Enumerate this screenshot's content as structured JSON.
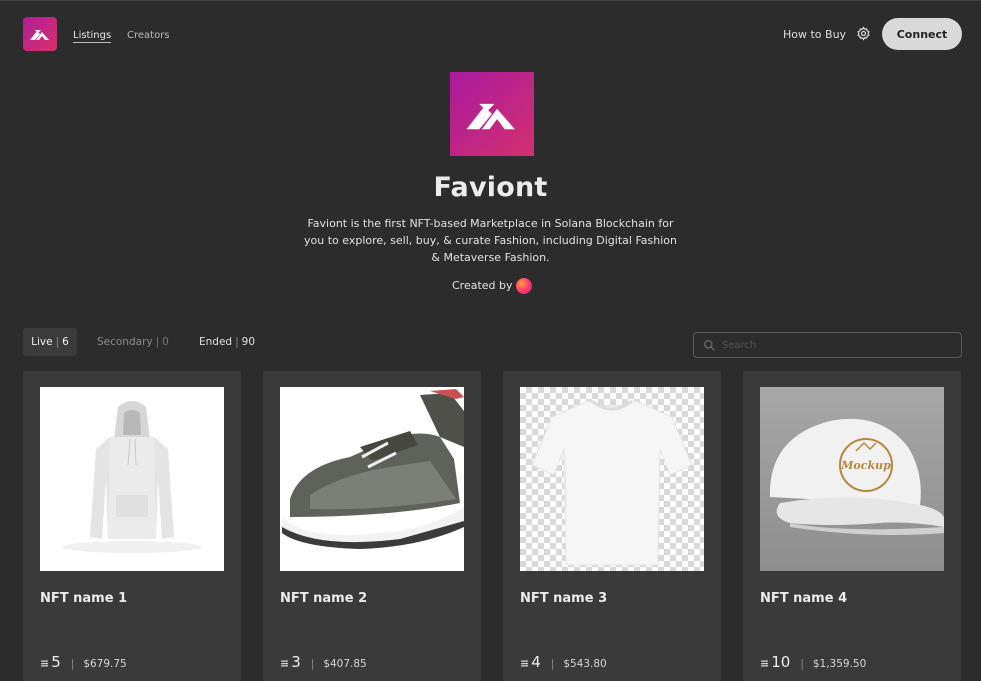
{
  "header": {
    "nav": [
      {
        "label": "Listings",
        "active": true
      },
      {
        "label": "Creators",
        "active": false
      }
    ],
    "how_to_buy": "How to Buy",
    "connect_label": "Connect",
    "settings_icon": "gear-icon"
  },
  "store": {
    "title": "Faviont",
    "description": "Faviont is the first NFT-based Marketplace in Solana Blockchain for you to explore, sell, buy, & curate Fashion, including Digital Fashion & Metaverse Fashion.",
    "created_by": "Created by"
  },
  "tabs": [
    {
      "label": "Live",
      "count": "6",
      "active": true
    },
    {
      "label": "Secondary",
      "count": "0",
      "active": false
    },
    {
      "label": "Ended",
      "count": "90",
      "active": false
    }
  ],
  "search": {
    "placeholder": "Search"
  },
  "listings": [
    {
      "name": "NFT name 1",
      "sol": "5",
      "usd": "$679.75",
      "image": "white-hoodie"
    },
    {
      "name": "NFT name 2",
      "sol": "3",
      "usd": "$407.85",
      "image": "grey-sneakers"
    },
    {
      "name": "NFT name 3",
      "sol": "4",
      "usd": "$543.80",
      "image": "white-tshirt"
    },
    {
      "name": "NFT name 4",
      "sol": "10",
      "usd": "$1,359.50",
      "image": "white-cap"
    }
  ],
  "colors": {
    "background": "#2c2c2c",
    "card": "#3a3a3a",
    "brand_gradient_start": "#b01e9a",
    "brand_gradient_end": "#d8306a",
    "connect_button": "#d9d9d9"
  }
}
